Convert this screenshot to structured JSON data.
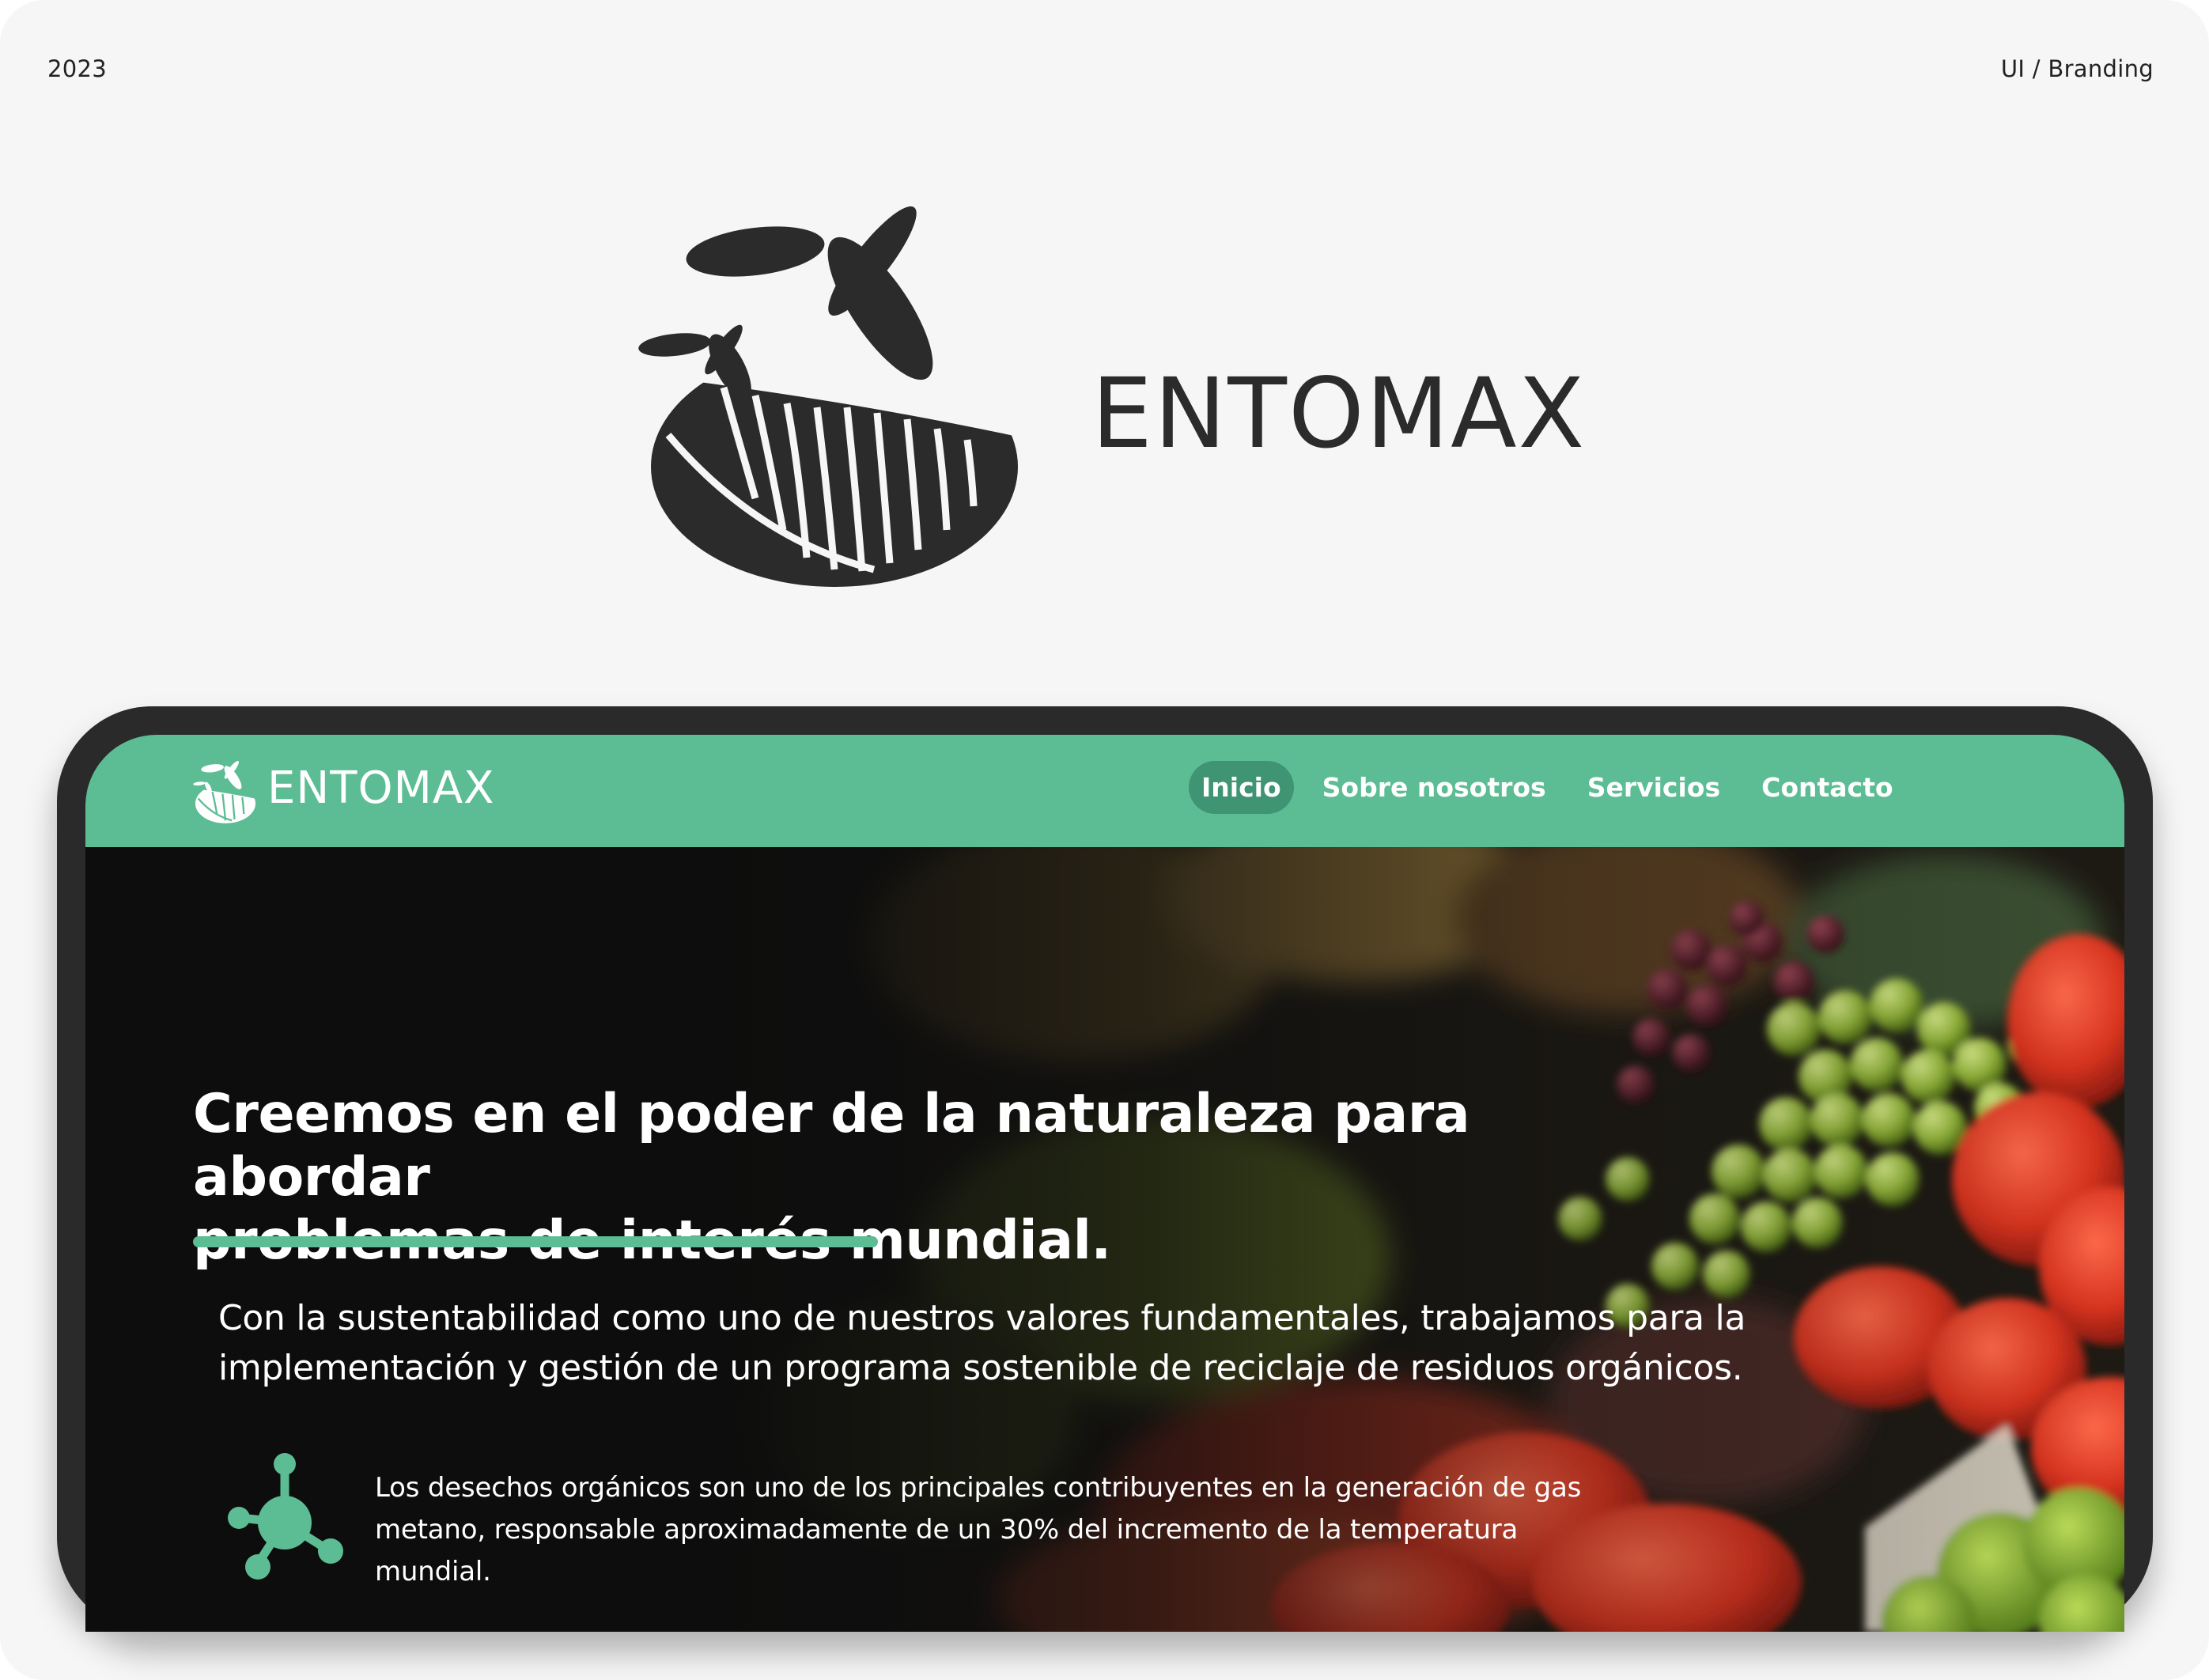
{
  "meta": {
    "year": "2023",
    "category": "UI / Branding"
  },
  "brand": {
    "name": "ENTOMAX",
    "mark_icon": "insect-larva-logo-icon"
  },
  "colors": {
    "primary_green": "#5cbd94",
    "active_nav": "#3e9473",
    "logo_dark": "#2b2b2b",
    "device_frame": "#2a2a2a"
  },
  "website": {
    "nav": {
      "brand": "ENTOMAX",
      "links": [
        {
          "label": "Inicio",
          "active": true
        },
        {
          "label": "Sobre nosotros",
          "active": false
        },
        {
          "label": "Servicios",
          "active": false
        },
        {
          "label": "Contacto",
          "active": false
        }
      ]
    },
    "hero": {
      "headline_line1": "Creemos en el poder de la naturaleza para abordar",
      "headline_line2": "problemas de interés mundial.",
      "paragraph_line1": "Con la sustentabilidad como uno de nuestros valores fundamentales, trabajamos para la",
      "paragraph_line2": "implementación y gestión de un programa sostenible de reciclaje de residuos orgánicos.",
      "fact_icon": "molecule-icon",
      "fact_line1": "Los desechos orgánicos son uno de los principales contribuyentes en la generación de gas",
      "fact_line2": "metano, responsable aproximadamente de un 30% del incremento de la temperatura",
      "fact_line3": "mundial."
    }
  }
}
